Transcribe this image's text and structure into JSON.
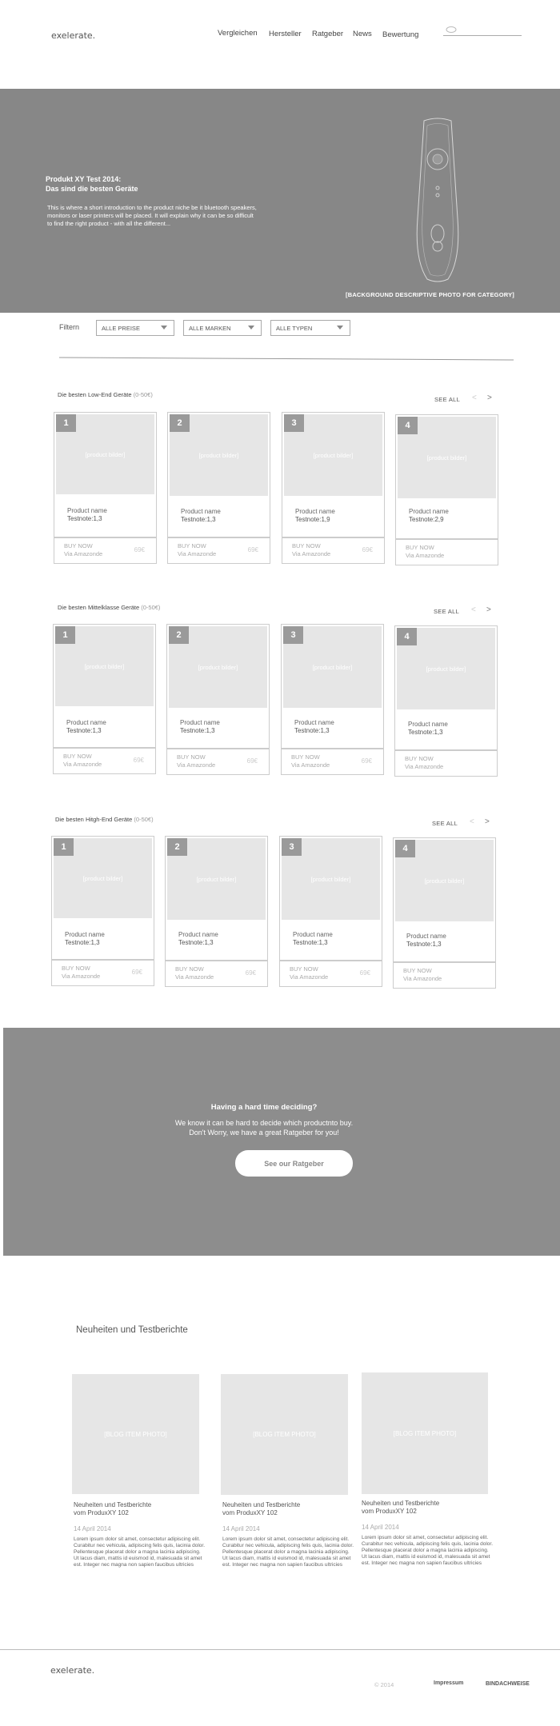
{
  "header": {
    "logo": "exelerate.",
    "nav": [
      "Vergleichen",
      "Hersteller",
      "Ratgeber",
      "News",
      "Bewertung"
    ]
  },
  "hero": {
    "title_line1": "Produkt XY Test 2014:",
    "title_line2": "Das sind die besten Geräte",
    "intro": "This is where a short introduction to the product niche be it bluetooth  speakers, monitors or  laser printers will be placed. It will explain  why it can be so difficult to find the right product - with all the different...",
    "caption": "[BACKGROUND DESCRIPTIVE PHOTO FOR CATEGORY]"
  },
  "filters": {
    "label": "Filtern",
    "selects": [
      "ALLE PREISE",
      "ALLE MARKEN",
      "ALLE TYPEN"
    ]
  },
  "sections": [
    {
      "title": "Die besten Low-End Geräte",
      "range": "(0-50€)",
      "see_all": "SEE ALL",
      "products": [
        {
          "rank": "1",
          "img": "[product bilder]",
          "name": "Product name",
          "note": "Testnote:1,3",
          "buy": "BUY NOW",
          "via": "Via Amazonde",
          "price": "69€"
        },
        {
          "rank": "2",
          "img": "[product bilder]",
          "name": "Product name",
          "note": "Testnote:1,3",
          "buy": "BUY NOW",
          "via": "Via Amazonde",
          "price": "69€"
        },
        {
          "rank": "3",
          "img": "[product bilder]",
          "name": "Product name",
          "note": "Testnote:1,9",
          "buy": "BUY NOW",
          "via": "Via Amazonde",
          "price": "69€"
        },
        {
          "rank": "4",
          "img": "[product bilder]",
          "name": "Product name",
          "note": "Testnote:2,9",
          "buy": "BUY NOW",
          "via": "Via Amazonde",
          "price": ""
        }
      ]
    },
    {
      "title": "Die besten Mittelklasse  Geräte",
      "range": "(0-50€)",
      "see_all": "SEE ALL",
      "products": [
        {
          "rank": "1",
          "img": "[product bilder]",
          "name": "Product name",
          "note": "Testnote:1,3",
          "buy": "BUY NOW",
          "via": "Via Amazonde",
          "price": "69€"
        },
        {
          "rank": "2",
          "img": "[product bilder]",
          "name": "Product name",
          "note": "Testnote:1,3",
          "buy": "BUY NOW",
          "via": "Via Amazonde",
          "price": "69€"
        },
        {
          "rank": "3",
          "img": "[product bilder]",
          "name": "Product name",
          "note": "Testnote:1,3",
          "buy": "BUY NOW",
          "via": "Via Amazonde",
          "price": "69€"
        },
        {
          "rank": "4",
          "img": "[product bilder]",
          "name": "Product name",
          "note": "Testnote:1,3",
          "buy": "BUY NOW",
          "via": "Via Amazonde",
          "price": ""
        }
      ]
    },
    {
      "title": "Die besten Hitgh-End Geräte",
      "range": "(0-50€)",
      "see_all": "SEE ALL",
      "products": [
        {
          "rank": "1",
          "img": "[product bilder]",
          "name": "Product name",
          "note": "Testnote:1,3",
          "buy": "BUY NOW",
          "via": "Via Amazonde",
          "price": "69€"
        },
        {
          "rank": "2",
          "img": "[product bilder]",
          "name": "Product name",
          "note": "Testnote:1,3",
          "buy": "BUY NOW",
          "via": "Via Amazonde",
          "price": "69€"
        },
        {
          "rank": "3",
          "img": "[product bilder]",
          "name": "Product name",
          "note": "Testnote:1,3",
          "buy": "BUY NOW",
          "via": "Via Amazonde",
          "price": "69€"
        },
        {
          "rank": "4",
          "img": "[product bilder]",
          "name": "Product name",
          "note": "Testnote:1,3",
          "buy": "BUY NOW",
          "via": "Via Amazonde",
          "price": ""
        }
      ]
    }
  ],
  "cta": {
    "heading": "Having  a hard time deciding?",
    "line1": "We know it can be hard to decide which productnto buy.",
    "line2": "Don't Worry, we have a great Ratgeber for you!",
    "button": "See our Ratgeber"
  },
  "blog": {
    "heading": "Neuheiten und Testberichte",
    "items": [
      {
        "img": "[BLOG ITEM PHOTO]",
        "title1": "Neuheiten und Testberichte",
        "title2": "vom ProduxXY 102",
        "date": "14 April 2014",
        "text": "Lorem ipsum dolor sit amet, consectetur adipiscing elit. Curabitur nec vehicula, adipiscing felis quis, lacinia dolor. Pellentesque placerat dolor a magna lacinia adipiscing. Ut lacus diam, mattis id euismod id,  malesuada sit amet est. Integer nec magna non sapien faucibus ultricies"
      },
      {
        "img": "[BLOG ITEM PHOTO]",
        "title1": "Neuheiten und Testberichte",
        "title2": "vom ProduxXY 102",
        "date": "14 April 2014",
        "text": "Lorem ipsum dolor sit amet, consectetur adipiscing elit. Curabitur nec vehicula, adipiscing felis quis, lacinia dolor. Pellentesque placerat dolor a magna lacinia adipiscing. Ut lacus diam, mattis id euismod id,  malesuada sit amet est. Integer nec magna non sapien faucibus ultricies"
      },
      {
        "img": "[BLOG ITEM PHOTO]",
        "title1": "Neuheiten und Testberichte",
        "title2": "vom ProduxXY 102",
        "date": "14 April 2014",
        "text": "Lorem ipsum dolor sit amet, consectetur adipiscing elit. Curabitur nec vehicula, adipiscing felis quis, lacinia dolor. Pellentesque placerat dolor a magna lacinia adipiscing. Ut lacus diam, mattis id euismod id,  malesuada sit amet est. Integer nec magna non sapien faucibus ultricies"
      }
    ]
  },
  "footer": {
    "logo": "exelerate.",
    "copyright": "© 2014",
    "links": [
      "Impressum",
      "BINDACHWEISE"
    ]
  }
}
